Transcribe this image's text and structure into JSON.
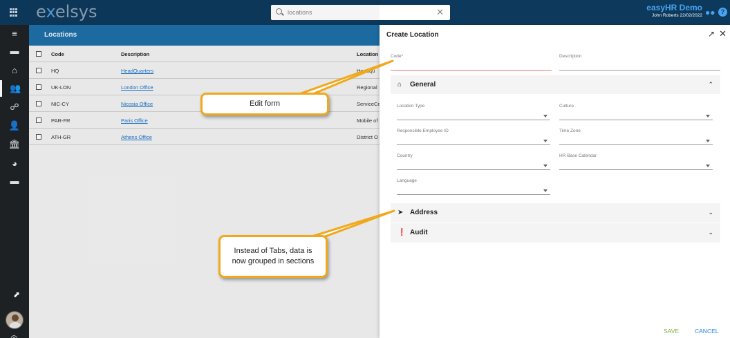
{
  "topbar": {
    "logo_pre": "e",
    "logo_x": "x",
    "logo_post": "elsys",
    "search_value": "locations",
    "clear_glyph": "✕",
    "brand_name": "easyHR Demo",
    "user_line": "John Roberts 22/02/2022",
    "help_glyph": "?"
  },
  "rail": {
    "icons": [
      "menu-icon",
      "folder-icon",
      "home-icon",
      "people-icon",
      "org-chart-icon",
      "user-minus-icon",
      "bank-icon",
      "pie-chart-icon",
      "folder-open-icon"
    ],
    "glyphs": [
      "≡",
      "▬",
      "⌂",
      "👥",
      "☍",
      "👤",
      "🏛",
      "◕",
      "▬"
    ]
  },
  "list": {
    "title": "Locations",
    "columns": {
      "code": "Code",
      "description": "Description",
      "location": "Location"
    },
    "rows": [
      {
        "code": "HQ",
        "description": "HeadQuarters",
        "location": "Headqu"
      },
      {
        "code": "UK-LON",
        "description": "London Office",
        "location": "Regional"
      },
      {
        "code": "NIC-CY",
        "description": "Nicosia Office",
        "location": "ServiceCe"
      },
      {
        "code": "PAR-FR",
        "description": "Paris Office",
        "location": "Mobile of"
      },
      {
        "code": "ATH-GR",
        "description": "Athens Office",
        "location": "District O"
      }
    ]
  },
  "form": {
    "title": "Create Location",
    "expand_glyph": "↗",
    "close_glyph": "✕",
    "code_label": "Code*",
    "description_label": "Description",
    "sections": {
      "general": "General",
      "address": "Address",
      "audit": "Audit"
    },
    "fields": {
      "location_type": "Location Type",
      "culture": "Culture",
      "responsible_employee": "Responsible Employee ID",
      "time_zone": "Time Zone",
      "country": "Country",
      "hr_base_calendar": "HR Base Calendar",
      "language": "Language"
    },
    "save_label": "SAVE",
    "cancel_label": "CANCEL"
  },
  "callouts": {
    "edit_form": "Edit form",
    "sections_note_line1": "Instead of Tabs, data is",
    "sections_note_line2": "now grouped in sections"
  },
  "colors": {
    "topbar": "#0d3a5c",
    "rail": "#1f2326",
    "list_header": "#1f6fa8",
    "accent_link": "#1a73c9",
    "save": "#7cb342",
    "cancel": "#1e88e5",
    "callout_border": "#f0a81c",
    "error_underline": "#e57373"
  }
}
